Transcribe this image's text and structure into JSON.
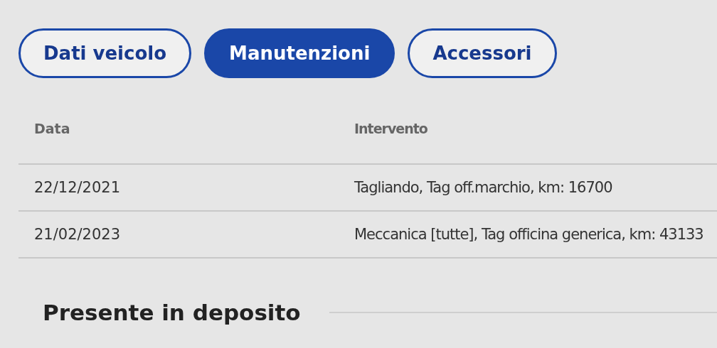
{
  "tabs": [
    {
      "label": "Dati veicolo",
      "selected": false
    },
    {
      "label": "Manutenzioni",
      "selected": true
    },
    {
      "label": "Accessori",
      "selected": false
    }
  ],
  "table": {
    "columns": [
      "Data",
      "Intervento"
    ],
    "rows": [
      [
        "22/12/2021",
        "Tagliando, Tag off.marchio, km: 16700"
      ],
      [
        "21/02/2023",
        "Meccanica [tutte], Tag officina generica, km: 43133"
      ]
    ]
  },
  "section": {
    "title": "Presente in deposito"
  }
}
